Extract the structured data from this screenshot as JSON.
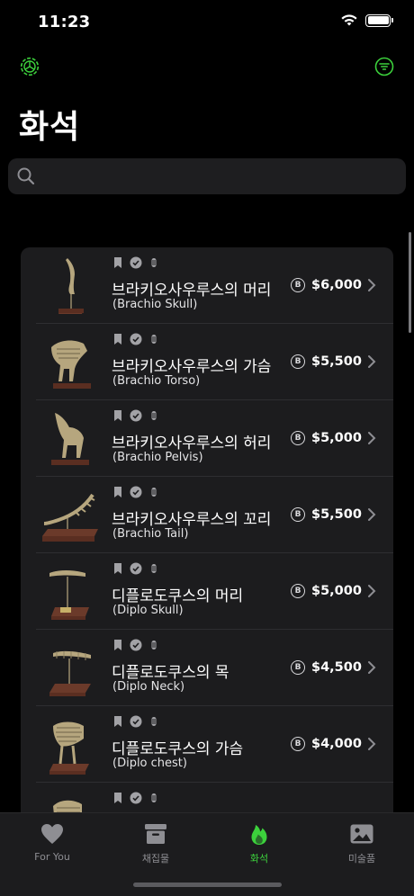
{
  "status": {
    "time": "11:23"
  },
  "header": {
    "title": "화석"
  },
  "search": {
    "placeholder": ""
  },
  "currency_symbol": "B",
  "items": [
    {
      "name": "브라키오사우루스의 머리",
      "sub": "(Brachio Skull)",
      "price": "$6,000"
    },
    {
      "name": "브라키오사우루스의 가슴",
      "sub": "(Brachio Torso)",
      "price": "$5,500"
    },
    {
      "name": "브라키오사우루스의 허리",
      "sub": "(Brachio Pelvis)",
      "price": "$5,000"
    },
    {
      "name": "브라키오사우루스의 꼬리",
      "sub": "(Brachio Tail)",
      "price": "$5,500"
    },
    {
      "name": "디플로도쿠스의 머리",
      "sub": "(Diplo Skull)",
      "price": "$5,000"
    },
    {
      "name": "디플로도쿠스의 목",
      "sub": "(Diplo Neck)",
      "price": "$4,500"
    },
    {
      "name": "디플로도쿠스의 가슴",
      "sub": "(Diplo chest)",
      "price": "$4,000"
    },
    {
      "name": "",
      "sub": "",
      "price": ""
    }
  ],
  "tabs": [
    {
      "label": "For You",
      "icon": "heart-icon"
    },
    {
      "label": "채집물",
      "icon": "archive-box-icon"
    },
    {
      "label": "화석",
      "icon": "flame-icon"
    },
    {
      "label": "미술품",
      "icon": "picture-icon"
    }
  ],
  "colors": {
    "accent": "#3cd13c",
    "background": "#000000",
    "card": "#1c1c1e"
  }
}
